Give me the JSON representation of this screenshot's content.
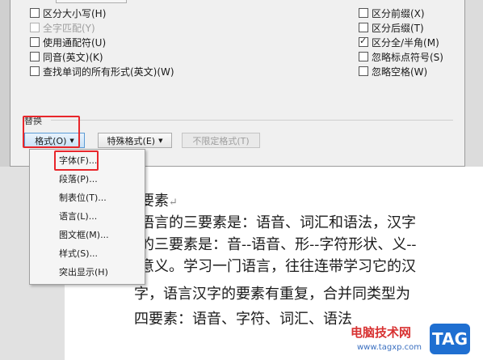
{
  "dialog": {
    "left_options": [
      {
        "label": "区分大小写(H)",
        "checked": false,
        "disabled": false
      },
      {
        "label": "全字匹配(Y)",
        "checked": false,
        "disabled": true
      },
      {
        "label": "使用通配符(U)",
        "checked": false,
        "disabled": false
      },
      {
        "label": "同音(英文)(K)",
        "checked": false,
        "disabled": false
      },
      {
        "label": "查找单词的所有形式(英文)(W)",
        "checked": false,
        "disabled": false
      }
    ],
    "right_options": [
      {
        "label": "区分前缀(X)",
        "checked": false
      },
      {
        "label": "区分后缀(T)",
        "checked": false
      },
      {
        "label": "区分全/半角(M)",
        "checked": true
      },
      {
        "label": "忽略标点符号(S)",
        "checked": false
      },
      {
        "label": "忽略空格(W)",
        "checked": false
      }
    ],
    "replace_group_title": "替换",
    "format_button": "格式(O)",
    "special_button": "特殊格式(E)",
    "no_format_button": "不限定格式(T)"
  },
  "format_menu": {
    "items": [
      "字体(F)...",
      "段落(P)...",
      "制表位(T)...",
      "语言(L)...",
      "图文框(M)...",
      "样式(S)...",
      "突出显示(H)"
    ]
  },
  "document": {
    "lines": [
      "要素",
      "语言的三要素是：语音、词汇和语法，汉字",
      "的三要素是：音--语音、形--字符形状、义--",
      "意义。学习一门语言，往往连带学习它的汉",
      "字，语言汉字的要素有重复，合并同类型为",
      "四要素：语音、字符、词汇、语法"
    ]
  },
  "watermark": {
    "text": "电脑技术网",
    "url": "www.tagxp.com",
    "logo": "TAG"
  },
  "colors": {
    "highlight": "#e8262b",
    "active_button": "#5b9bd5",
    "watermark_logo": "#1f6fd1"
  }
}
